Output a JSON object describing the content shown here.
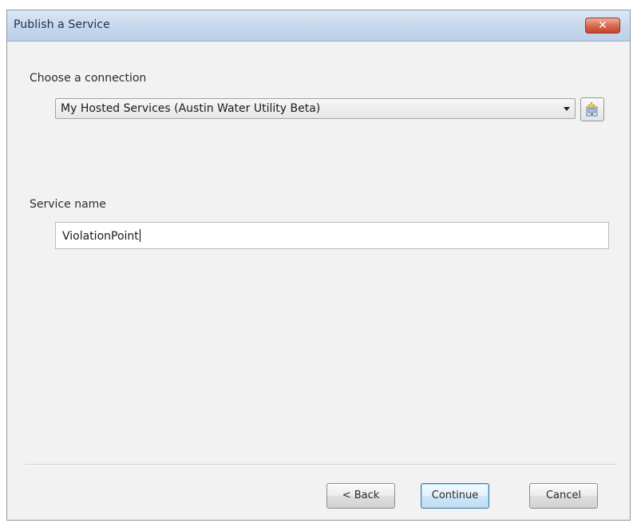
{
  "window": {
    "title": "Publish a Service",
    "close_label": "✕"
  },
  "connection": {
    "label": "Choose a connection",
    "selected": "My Hosted Services (Austin Water Utility Beta)"
  },
  "service": {
    "label": "Service name",
    "value": "ViolationPoint"
  },
  "footer": {
    "back_label": "< Back",
    "continue_label": "Continue",
    "cancel_label": "Cancel"
  },
  "icons": {
    "close": "close-icon",
    "dropdown": "chevron-down-icon",
    "add_connection": "add-connection-icon"
  },
  "colors": {
    "title_bar": "#c6d7ec",
    "close_button": "#d96b51",
    "default_button_border": "#3c7fb1"
  }
}
